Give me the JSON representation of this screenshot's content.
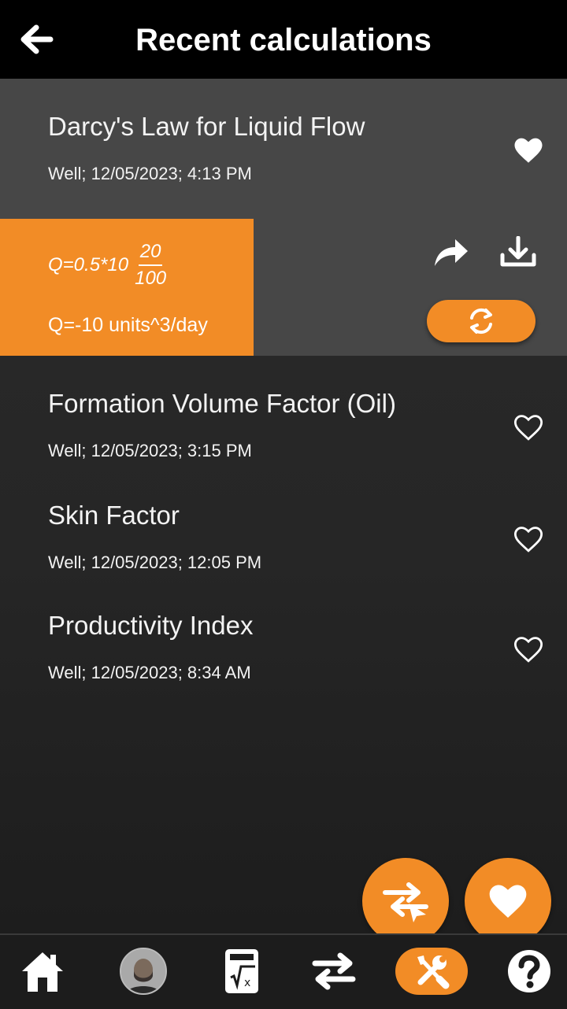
{
  "header": {
    "title": "Recent calculations",
    "back_icon": "arrow-left-icon"
  },
  "items": [
    {
      "title": "Darcy's Law for Liquid Flow",
      "subtitle": "Well; 12/05/2023; 4:13 PM",
      "favorite": true
    },
    {
      "title": "Formation Volume Factor (Oil)",
      "subtitle": "Well; 12/05/2023; 3:15 PM",
      "favorite": false
    },
    {
      "title": "Skin Factor",
      "subtitle": "Well; 12/05/2023; 12:05 PM",
      "favorite": false
    },
    {
      "title": "Productivity Index",
      "subtitle": "Well; 12/05/2023; 8:34 AM",
      "favorite": false
    }
  ],
  "detail": {
    "formula_prefix": "Q=0.5*10",
    "fraction_numerator": "20",
    "fraction_denominator": "100",
    "result": "Q=-10 units^3/day",
    "actions": [
      "share-icon",
      "download-icon",
      "refresh-icon"
    ]
  },
  "fabs": [
    "swap-icon",
    "heart-icon"
  ],
  "bottom_nav": [
    "home-icon",
    "avatar",
    "calculator-icon",
    "swap-icon",
    "tools-icon",
    "help-icon"
  ],
  "colors": {
    "accent": "#f28c26",
    "header_bg": "#000000",
    "expanded_bg": "#474747",
    "text": "#f3f3f3"
  }
}
